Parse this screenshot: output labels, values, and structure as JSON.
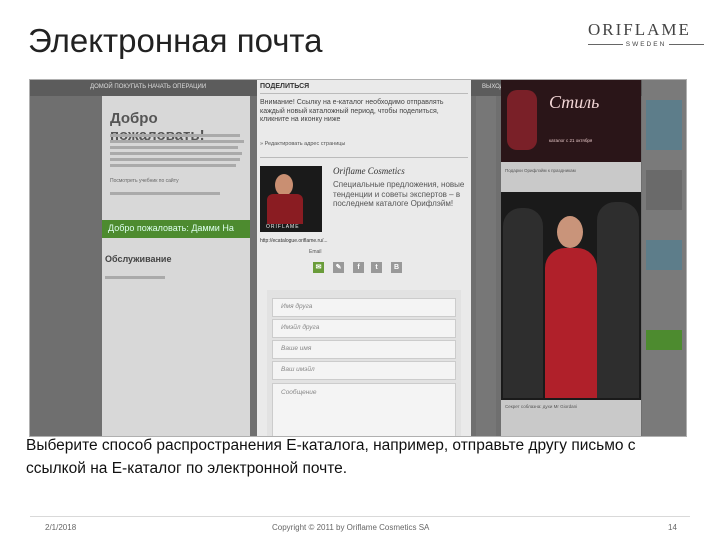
{
  "slide": {
    "title": "Электронная почта",
    "logo_top": "ORIFLAME",
    "logo_bottom": "SWEDEN",
    "caption": "Выберите способ распространения Е-каталога, например, отправьте другу письмо с ссылкой на Е-каталог по электронной почте.",
    "footer_date": "2/1/2018",
    "footer_copyright": "Copyright © 2011 by Oriflame Cosmetics SA",
    "footer_page": "14"
  },
  "screenshot": {
    "left": {
      "welcome": "Добро пожаловать!",
      "hint_link": "Посмотреть учебник по сайту",
      "green_button": "Добро пожаловать: Дамми На",
      "service": "Обслуживание"
    },
    "share_popup": {
      "header": "ПОДЕЛИТЬСЯ",
      "warning": "Внимание! Ссылку на е-каталог необходимо отправлять каждый новый каталожный период, чтобы поделиться, кликните на иконку ниже",
      "edit_link": "» Редактировать адрес страницы",
      "card_title": "Oriflame Cosmetics",
      "card_body": "Специальные предложения, новые тенденции и советы экспертов – в последнем каталоге Орифлэйм!",
      "cover_brand": "ORIFLAME",
      "url": "http://ecatalogue.oriflame.ru/...",
      "email_tooltip": "Email",
      "form": {
        "friend_name": "Имя друга",
        "friend_email": "Имэйл друга",
        "your_name": "Ваше имя",
        "your_email": "Ваш имэйл",
        "message": "Сообщение"
      }
    },
    "right_ad": {
      "headline": "Стиль",
      "sub": "каталог с 21 октября",
      "mid_caption": "Подарки Орифлэйм к праздникам",
      "bottom_caption": "Секрет соблазна: духи Mr Giordani"
    },
    "colors": {
      "accent_green": "#4d8b2f",
      "ad_red": "#b0202a"
    }
  }
}
